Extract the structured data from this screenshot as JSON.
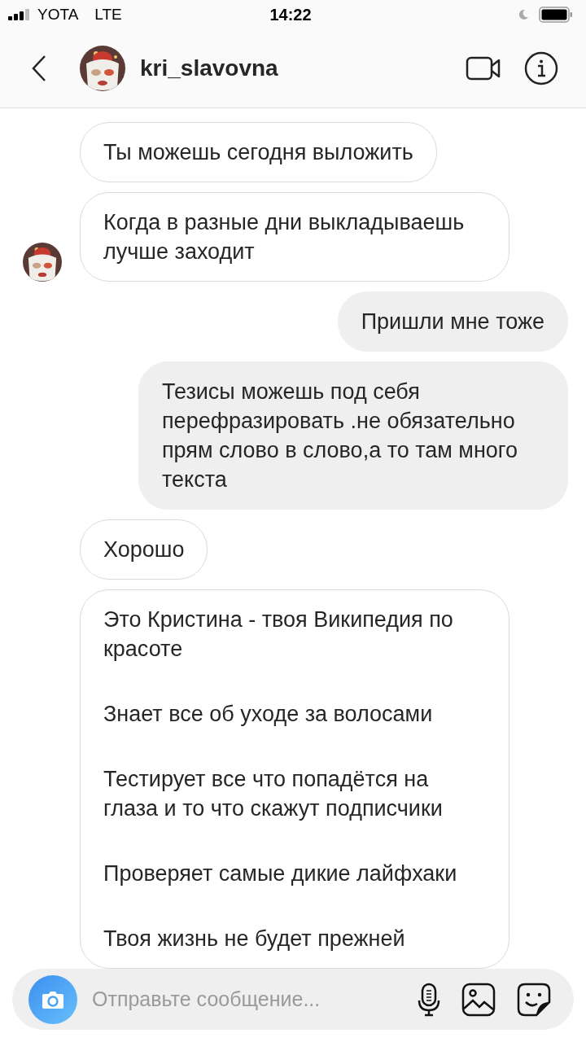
{
  "status_bar": {
    "carrier": "YOTA",
    "network": "LTE",
    "time": "14:22"
  },
  "header": {
    "username": "kri_slavovna"
  },
  "messages": [
    {
      "kind": "incoming",
      "show_avatar": false,
      "paragraphs": [
        "Ты можешь сегодня выложить"
      ]
    },
    {
      "kind": "incoming",
      "show_avatar": true,
      "paragraphs": [
        "Когда в разные дни выкладываешь лучше заходит"
      ]
    },
    {
      "kind": "outgoing",
      "paragraphs": [
        "Пришли мне тоже"
      ]
    },
    {
      "kind": "outgoing",
      "paragraphs": [
        "Тезисы можешь под себя перефразировать .не обязательно прям слово в слово,а то там много текста"
      ]
    },
    {
      "kind": "incoming",
      "show_avatar": false,
      "paragraphs": [
        "Хорошо"
      ]
    },
    {
      "kind": "incoming",
      "show_avatar": false,
      "paragraphs": [
        "Это Кристина - твоя Википедия по красоте",
        "Знает все об уходе за волосами",
        "Тестирует все что попадётся на глаза и то что скажут подписчики",
        "Проверяет самые дикие лайфхаки",
        "Твоя жизнь не будет прежней"
      ]
    }
  ],
  "composer": {
    "placeholder": "Отправьте сообщение..."
  }
}
